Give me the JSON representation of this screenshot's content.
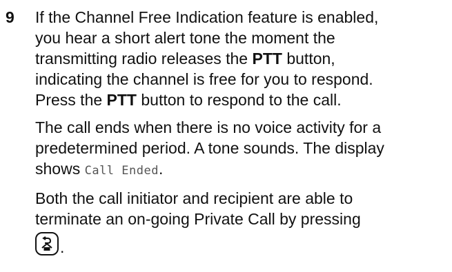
{
  "step": {
    "number": "9"
  },
  "para1": {
    "t1": "If the Channel Free Indication feature is enabled,",
    "t2": "you hear a short alert tone the moment the",
    "t3": "transmitting radio releases the ",
    "k1": "PTT",
    "t4": " button,",
    "t5": "indicating the channel is free for you to respond.",
    "t6": "Press the ",
    "k2": "PTT",
    "t7": " button to respond to the call."
  },
  "para2": {
    "t1": "The call ends when there is no voice activity for a",
    "t2": "predetermined period. A tone sounds. The display",
    "t3": "shows ",
    "display_text": "Call Ended",
    "t4": "."
  },
  "para3": {
    "t1": "Both the call initiator and recipient are able to",
    "t2": "terminate an on-going Private Call by pressing"
  },
  "key": {
    "icon": "back-home-key-icon",
    "suffix": "."
  }
}
